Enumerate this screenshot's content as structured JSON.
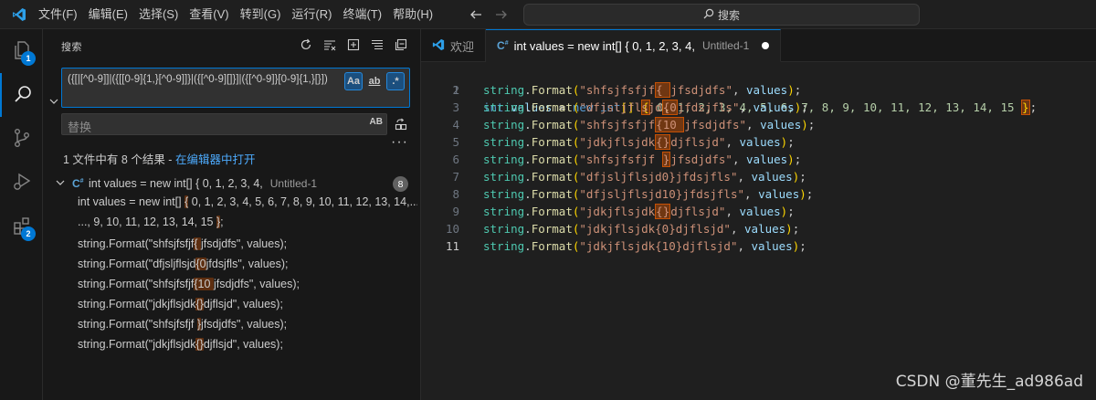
{
  "titlebar": {
    "menu": [
      "文件(F)",
      "编辑(E)",
      "选择(S)",
      "查看(V)",
      "转到(G)",
      "运行(R)",
      "终端(T)",
      "帮助(H)"
    ],
    "search_label": "搜索"
  },
  "activitybar": {
    "explorer_badge": "1",
    "extensions_badge": "2"
  },
  "sidebar": {
    "title": "搜索",
    "search_value": "({[|[^0-9]]|({[[0-9]{1,}[^0-9]]}|({[^0-9][]}]|({[^0-9]}[0-9]{1,}[}])",
    "opt_case": "Aa",
    "opt_word": "ab",
    "opt_regex": ".*",
    "replace_placeholder": "替换",
    "replace_preserve": "AB",
    "result_summary_prefix": "1 文件中有 8 个结果 - ",
    "result_summary_link": "在编辑器中打开",
    "file": {
      "name": "int values = new int[] { 0, 1, 2, 3, 4,",
      "path": "Untitled-1",
      "count": "8"
    },
    "matches": [
      {
        "pre": "int values = new int[] ",
        "hl": "{",
        "post": " 0, 1, 2, 3, 4, 5, 6, 7, 8, 9, 10, 11, 12, 13, 14,..."
      },
      {
        "pre": "..., 9, 10, 11, 12, 13, 14, 15 ",
        "hl": "}",
        "post": ";"
      },
      {
        "pre": "string.Format(\"shfsjfsfjf",
        "hl": "{ ",
        "post": "jfsdjdfs\", values);"
      },
      {
        "pre": "string.Format(\"dfjsljflsjd",
        "hl": "{0",
        "post": "jfdsjfls\", values);"
      },
      {
        "pre": "string.Format(\"shfsjfsfjf",
        "hl": "{10 ",
        "post": "jfsdjdfs\", values);"
      },
      {
        "pre": "string.Format(\"jdkjflsjdk",
        "hl": "{}",
        "post": "djflsjd\", values);"
      },
      {
        "pre": "string.Format(\"shfsjfsfjf ",
        "hl": "}",
        "post": "jfsdjdfs\", values);"
      },
      {
        "pre": "string.Format(\"jdkjflsjdk",
        "hl": "{}",
        "post": "djflsjd\", values);"
      }
    ]
  },
  "editor": {
    "tabs": [
      {
        "label": "欢迎",
        "sub": ""
      },
      {
        "label": "int values = new int[] { 0, 1, 2, 3, 4,",
        "sub": "Untitled-1"
      }
    ],
    "line1": {
      "kw1": "int",
      "var1": " values",
      "eq": " = ",
      "kw2": "new",
      "ty": " int",
      "br": "[]",
      "open": "{",
      "nums": " 0, 1, 2, 3, 4, 5, 6, 7, 8, 9, 10, 11, 12, 13, 14, 15 ",
      "close": "}",
      "end": ";"
    },
    "lines": [
      {
        "n": "2",
        "pre": "\"shfsjfsfjf",
        "hl": "{ ",
        "post": "jfsdjdfs\""
      },
      {
        "n": "3",
        "pre": "\"dfjsljflsjd",
        "hl": "{0",
        "post": "jfdsjfls\""
      },
      {
        "n": "4",
        "pre": "\"shfsjfsfjf",
        "hl": "{10 ",
        "post": "jfsdjdfs\""
      },
      {
        "n": "5",
        "pre": "\"jdkjflsjdk",
        "hl": "{}",
        "post": "djflsjd\""
      },
      {
        "n": "6",
        "pre": "\"shfsjfsfjf ",
        "hl": "}",
        "post": "jfsdjdfs\""
      },
      {
        "n": "7",
        "pre": "\"dfjsljflsjd0}jfdsjfls\"",
        "hl": "",
        "post": ""
      },
      {
        "n": "8",
        "pre": "\"dfjsljflsjd10}jfdsjfls\"",
        "hl": "",
        "post": ""
      },
      {
        "n": "9",
        "pre": "\"jdkjflsjdk",
        "hl": "{}",
        "post": "djflsjd\""
      },
      {
        "n": "10",
        "pre": "\"jdkjflsjdk{0}djflsjd\"",
        "hl": "",
        "post": ""
      },
      {
        "n": "11",
        "pre": "\"jdkjflsjdk{10}djflsjd\"",
        "hl": "",
        "post": ""
      }
    ],
    "string_type": "string",
    "format_fn": "Format",
    "args_var": "values",
    "line1_no": "1"
  },
  "watermark": "CSDN @董先生_ad986ad"
}
